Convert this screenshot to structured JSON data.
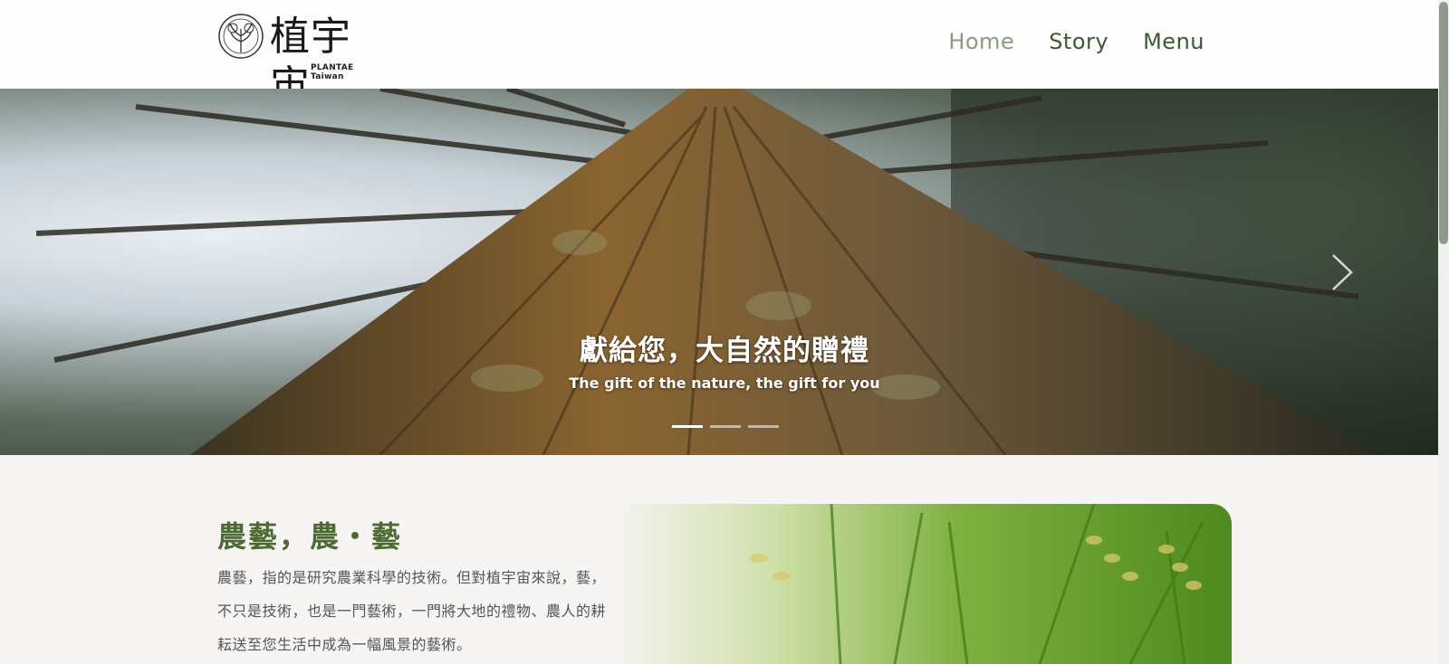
{
  "header": {
    "logo": {
      "name_cn": "植宇宙",
      "name_en": "PLANTAE Taiwan",
      "emblem_text": "PLANTAE Taiwan"
    },
    "nav": [
      {
        "label": "Home",
        "active": true
      },
      {
        "label": "Story",
        "active": false
      },
      {
        "label": "Menu",
        "active": false
      }
    ]
  },
  "hero": {
    "title": "獻給您，大自然的贈禮",
    "subtitle": "The gift of the nature, the gift for you",
    "slides_count": 3,
    "active_slide": 1
  },
  "section": {
    "title": "農藝，農・藝",
    "body": "農藝，指的是研究農業科學的技術。但對植宇宙來說，藝，不只是技術，也是一門藝術，一門將大地的禮物、農人的耕耘送至您生活中成為一幅風景的藝術。"
  },
  "colors": {
    "brand_green": "#4e6a34",
    "nav_active": "#8a9c7c",
    "nav_text": "#3e5a2d"
  }
}
